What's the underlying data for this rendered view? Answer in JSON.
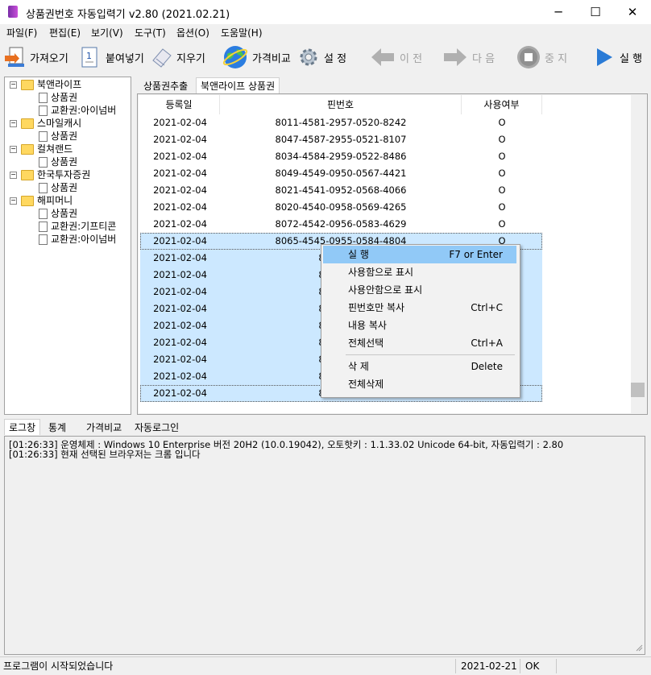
{
  "window": {
    "title": "상품권번호 자동입력기 v2.80 (2021.02.21)",
    "minimize": "─",
    "maximize": "☐",
    "close": "✕"
  },
  "menu": [
    "파일(F)",
    "편집(E)",
    "보기(V)",
    "도구(T)",
    "옵션(O)",
    "도움말(H)"
  ],
  "toolbar": {
    "fetch": "가져오기",
    "paste": "붙여넣기",
    "erase": "지우기",
    "compare": "가격비교",
    "settings": "설 정",
    "prev": "이 전",
    "next": "다 음",
    "stop": "중 지",
    "run": "실 행"
  },
  "tree": [
    {
      "label": "북앤라이프",
      "children": [
        "상품권",
        "교환권:아이넘버"
      ]
    },
    {
      "label": "스마일캐시",
      "children": [
        "상품권"
      ]
    },
    {
      "label": "컬쳐랜드",
      "children": [
        "상품권"
      ]
    },
    {
      "label": "한국투자증권",
      "children": [
        "상품권"
      ]
    },
    {
      "label": "해피머니",
      "children": [
        "상품권",
        "교환권:기프티콘",
        "교환권:아이넘버"
      ]
    }
  ],
  "tabs": [
    "상품권추출",
    "북앤라이프 상품권"
  ],
  "table": {
    "headers": [
      "등록일",
      "핀번호",
      "사용여부"
    ],
    "rows": [
      [
        "2021-02-04",
        "8011-4581-2957-0520-8242",
        "O"
      ],
      [
        "2021-02-04",
        "8047-4587-2955-0521-8107",
        "O"
      ],
      [
        "2021-02-04",
        "8034-4584-2959-0522-8486",
        "O"
      ],
      [
        "2021-02-04",
        "8049-4549-0950-0567-4421",
        "O"
      ],
      [
        "2021-02-04",
        "8021-4541-0952-0568-4066",
        "O"
      ],
      [
        "2021-02-04",
        "8020-4540-0958-0569-4265",
        "O"
      ],
      [
        "2021-02-04",
        "8072-4542-0956-0583-4629",
        "O"
      ],
      [
        "2021-02-04",
        "8065-4545-0955-0584-4804",
        "O"
      ],
      [
        "2021-02-04",
        "8024-454",
        ""
      ],
      [
        "2021-02-04",
        "8039-454",
        ""
      ],
      [
        "2021-02-04",
        "8076-454",
        ""
      ],
      [
        "2021-02-04",
        "8011-454",
        ""
      ],
      [
        "2021-02-04",
        "8052-454",
        ""
      ],
      [
        "2021-02-04",
        "8086-454",
        ""
      ],
      [
        "2021-02-04",
        "8036-454",
        ""
      ],
      [
        "2021-02-04",
        "8099-454",
        ""
      ],
      [
        "2021-02-04",
        "8029-454",
        ""
      ]
    ]
  },
  "context_menu": {
    "items": [
      {
        "label": "실 행",
        "shortcut": "F7 or Enter"
      },
      {
        "label": "사용함으로 표시",
        "shortcut": ""
      },
      {
        "label": "사용안함으로 표시",
        "shortcut": ""
      },
      {
        "label": "핀번호만 복사",
        "shortcut": "Ctrl+C"
      },
      {
        "label": "내용 복사",
        "shortcut": ""
      },
      {
        "label": "전체선택",
        "shortcut": "Ctrl+A"
      },
      {
        "label": "삭 제",
        "shortcut": "Delete"
      },
      {
        "label": "전체삭제",
        "shortcut": ""
      }
    ]
  },
  "log_tabs": [
    "로그창",
    "통계",
    "가격비교",
    "자동로그인"
  ],
  "log_lines": [
    "[01:26:33] 운영체제 : Windows 10 Enterprise 버전 20H2 (10.0.19042), 오토핫키 : 1.1.33.02 Unicode 64-bit, 자동입력기 : 2.80",
    "[01:26:33] 현재 선택된 브라우저는 크롬 입니다"
  ],
  "status": {
    "message": "프로그램이 시작되었습니다",
    "date": "2021-02-21",
    "state": "OK"
  },
  "colors": {
    "selection": "#cce8ff",
    "menu_highlight": "#91c9f7",
    "folder": "#ffd860"
  }
}
